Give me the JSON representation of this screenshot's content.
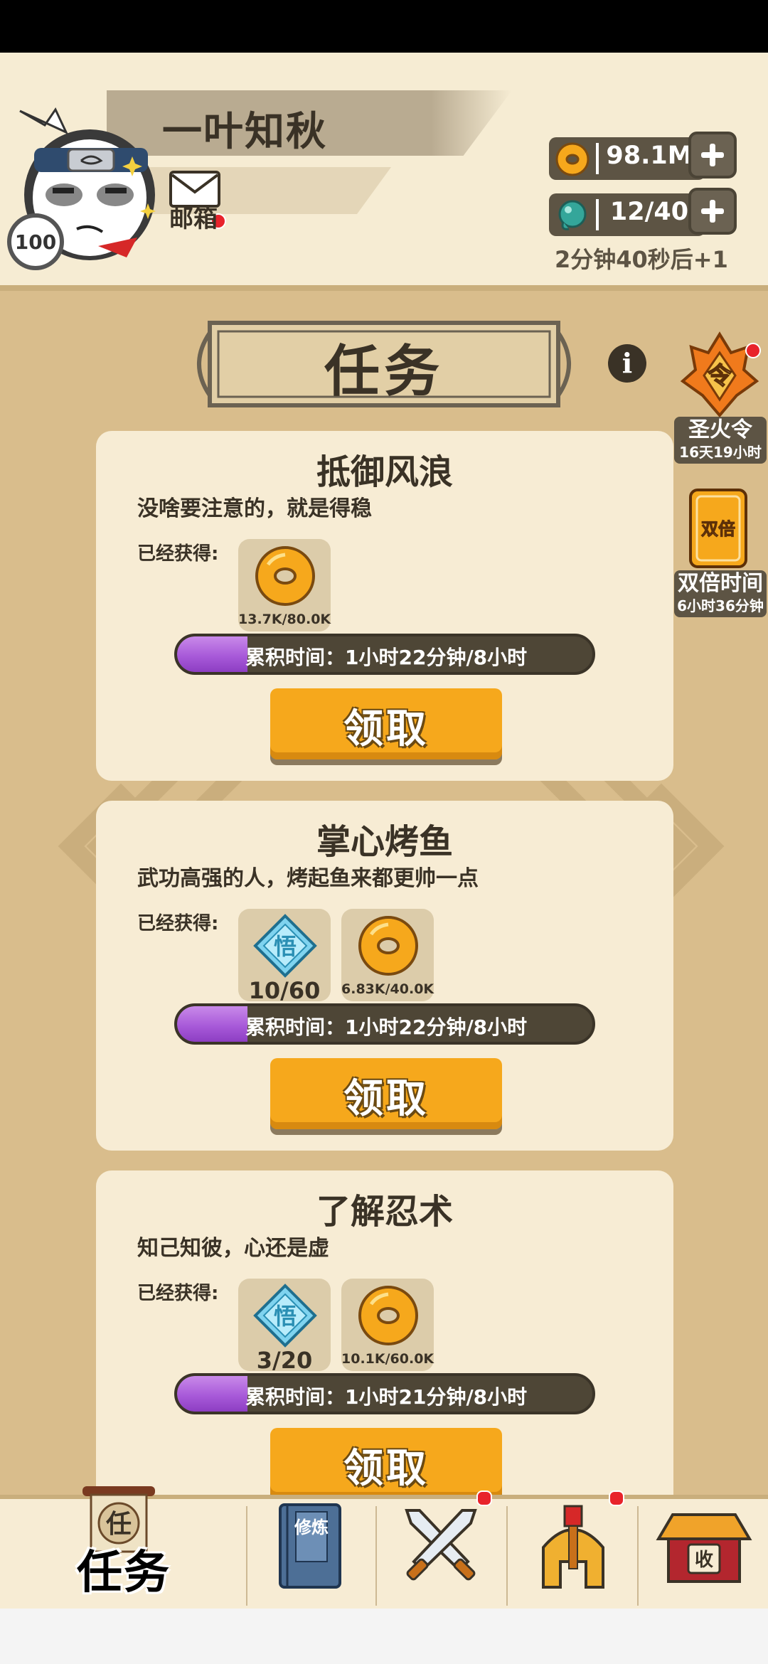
{
  "player": {
    "name": "一叶知秋",
    "level": "100",
    "mail_label": "邮箱"
  },
  "resources": {
    "coins": "98.1M",
    "energy": "12/40",
    "energy_timer": "2分钟40秒后+1"
  },
  "page": {
    "title": "任务"
  },
  "side_events": [
    {
      "name": "圣火令",
      "time": "16天19小时",
      "icon_text": "令"
    },
    {
      "name": "双倍时间",
      "time": "6小时36分钟",
      "icon_text": "双倍"
    }
  ],
  "tasks": [
    {
      "title": "抵御风浪",
      "description": "没啥要注意的，就是得稳",
      "obtained_label": "已经获得:",
      "rewards": [
        {
          "icon": "coin-icon",
          "count": "13.7K/80.0K"
        }
      ],
      "progress_text": "累积时间：1小时22分钟/8小时",
      "progress_ratio": 0.17,
      "claim_label": "领取"
    },
    {
      "title": "掌心烤鱼",
      "description": "武功高强的人，烤起鱼来都更帅一点",
      "obtained_label": "已经获得:",
      "rewards": [
        {
          "icon": "insight-gem-icon",
          "glyph": "悟",
          "count": "10/60"
        },
        {
          "icon": "coin-icon",
          "count": "6.83K/40.0K"
        }
      ],
      "progress_text": "累积时间：1小时22分钟/8小时",
      "progress_ratio": 0.17,
      "claim_label": "领取"
    },
    {
      "title": "了解忍术",
      "description": "知己知彼，心还是虚",
      "obtained_label": "已经获得:",
      "rewards": [
        {
          "icon": "insight-gem-icon",
          "glyph": "悟",
          "count": "3/20"
        },
        {
          "icon": "coin-icon",
          "count": "10.1K/60.0K"
        }
      ],
      "progress_text": "累积时间：1小时21分钟/8小时",
      "progress_ratio": 0.17,
      "claim_label": "领取"
    }
  ],
  "bottom_nav": {
    "active_label": "任务",
    "tabs": [
      {
        "icon": "task-scroll-icon",
        "glyph": "任"
      },
      {
        "icon": "training-book-icon",
        "glyph": "修炼"
      },
      {
        "icon": "crossed-swords-icon"
      },
      {
        "icon": "helmet-icon"
      },
      {
        "icon": "shop-house-icon",
        "glyph": "收"
      }
    ]
  },
  "colors": {
    "background": "#d9bd8c",
    "card": "#f7ecd4",
    "accent_orange": "#f6a81c",
    "progress_purple": "#a85ad9",
    "dark_text": "#3a3226",
    "notification_red": "#e8232b"
  }
}
